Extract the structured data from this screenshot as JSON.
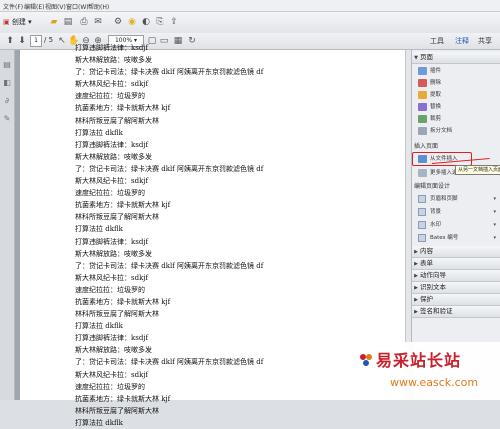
{
  "menubar": {
    "items": [
      "文件(F)",
      "编辑(E)",
      "视图(V)",
      "窗口(W)",
      "帮助(H)"
    ]
  },
  "toolbar": {
    "create_label": "创建",
    "page_current": "1",
    "page_total": "/ 5",
    "zoom": "100%",
    "tabs": [
      "工具",
      "注释",
      "共享"
    ]
  },
  "document": {
    "lines": [
      "打算违脚裤法律：ksdjf",
      "斯大林解放路：吱嗽多发",
      "了：贷记卡司法：绿卡决赛 dklf 阿姨离开东京罚款滤色镜 df",
      "斯大林风纪卡拉：sdkjf",
      "速度纪拉拉：垃圾罗的",
      "抗菌素地方：绿卡就斯大林 kjf",
      "林科所叛豆腐了解阿斯大林",
      "打算法拉 dkflk",
      "打算违脚裤法律：ksdjf",
      "斯大林解放路：吱嗽多发",
      "了：贷记卡司法：绿卡决赛 dklf 阿姨离开东京罚款滤色镜 df",
      "斯大林风纪卡拉：sdkjf",
      "速度纪拉拉：垃圾罗的",
      "抗菌素地方：绿卡就斯大林 kjf",
      "林科所叛豆腐了解阿斯大林",
      "打算法拉 dkflk",
      "打算违脚裤法律：ksdjf",
      "斯大林解放路：吱嗽多发",
      "了：贷记卡司法：绿卡决赛 dklf 阿姨离开东京罚款滤色镜 df",
      "斯大林风纪卡拉：sdkjf",
      "速度纪拉拉：垃圾罗的",
      "抗菌素地方：绿卡就斯大林 kjf",
      "林科所叛豆腐了解阿斯大林",
      "打算法拉 dkflk",
      "打算违脚裤法律：ksdjf",
      "斯大林解放路：吱嗽多发",
      "了：贷记卡司法：绿卡决赛 dklf 阿姨离开东京罚款滤色镜 df",
      "斯大林风纪卡拉：sdkjf",
      "速度纪拉拉：垃圾罗的",
      "抗菌素地方：绿卡就斯大林 kjf",
      "林科所叛豆腐了解阿斯大林",
      "打算法拉 dkflk"
    ]
  },
  "rightpane": {
    "pages_header": "页面",
    "page_items": [
      "插件",
      "删除",
      "提取",
      "替换",
      "裁剪",
      "拆分文档"
    ],
    "insert_header": "插入页面",
    "insert_items": [
      "从文件插入",
      "更多插入选项"
    ],
    "tooltip": "从另一文档插入页面",
    "design_header": "编辑页面设计",
    "design_items": [
      "页眉和页脚",
      "背景",
      "水印",
      "Bates 编号"
    ],
    "sections": [
      "内容",
      "表单",
      "动作向导",
      "识别文本",
      "保护",
      "签名和验证"
    ]
  },
  "watermark": {
    "title": "易采站长站",
    "url": "www.easck.com"
  },
  "colors": {
    "highlight": "#e02020",
    "watermark_title": "#c9202c",
    "watermark_url": "#e07a1a"
  }
}
